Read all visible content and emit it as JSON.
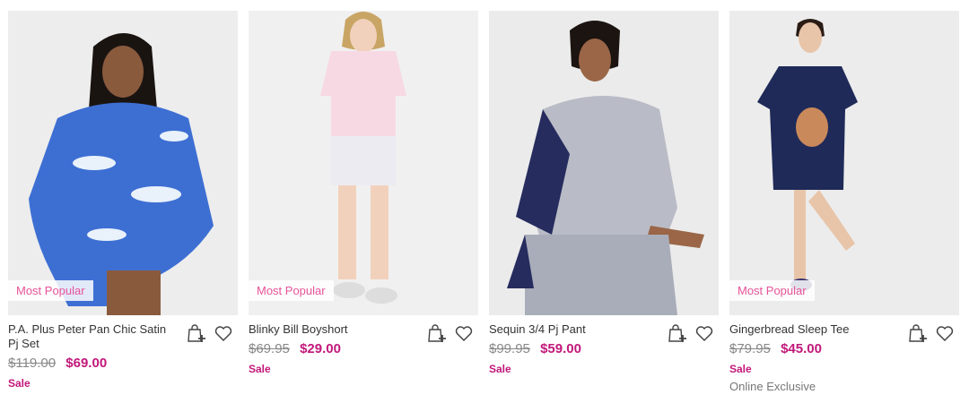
{
  "products": [
    {
      "name": "P.A. Plus Peter Pan Chic Satin Pj Set",
      "badge": "Most Popular",
      "was_price": "$119.00",
      "now_price": "$69.00",
      "sale_label": "Sale",
      "extra": ""
    },
    {
      "name": "Blinky Bill Boyshort",
      "badge": "Most Popular",
      "was_price": "$69.95",
      "now_price": "$29.00",
      "sale_label": "Sale",
      "extra": ""
    },
    {
      "name": "Sequin 3/4 Pj Pant",
      "badge": "",
      "was_price": "$99.95",
      "now_price": "$59.00",
      "sale_label": "Sale",
      "extra": ""
    },
    {
      "name": "Gingerbread Sleep Tee",
      "badge": "Most Popular",
      "was_price": "$79.95",
      "now_price": "$45.00",
      "sale_label": "Sale",
      "extra": "Online Exclusive"
    }
  ],
  "icons": {
    "add_to_bag": "shopping-bag-plus-icon",
    "wishlist": "heart-icon"
  },
  "colors": {
    "sale": "#c2187a",
    "badge": "#e8549a",
    "strike": "#888888"
  }
}
